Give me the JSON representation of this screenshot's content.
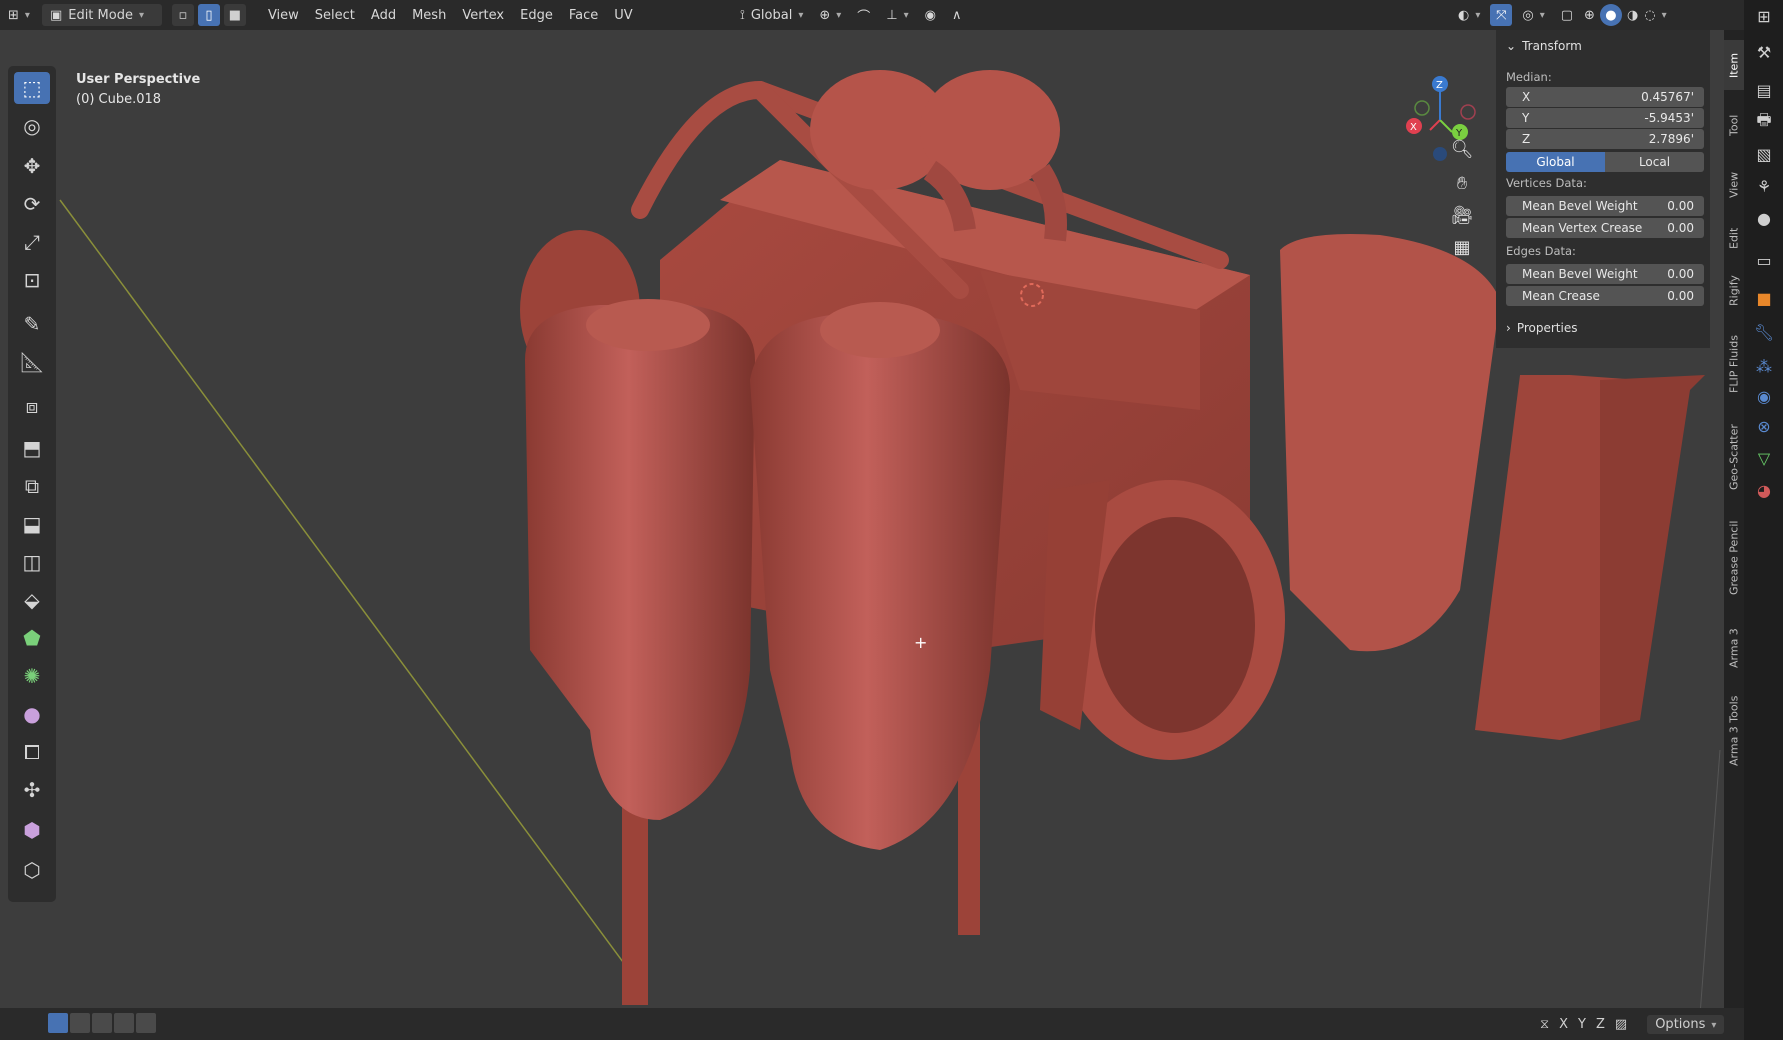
{
  "header": {
    "mode_label": "Edit Mode",
    "menu": [
      "View",
      "Select",
      "Add",
      "Mesh",
      "Vertex",
      "Edge",
      "Face",
      "UV"
    ],
    "transform_orientation": "Global"
  },
  "viewport": {
    "perspective_label": "User Perspective",
    "object_label": "(0) Cube.018"
  },
  "npanel": {
    "transform_title": "Transform",
    "median_label": "Median:",
    "x_label": "X",
    "x_value": "0.45767'",
    "y_label": "Y",
    "y_value": "-5.9453'",
    "z_label": "Z",
    "z_value": "2.7896'",
    "global_label": "Global",
    "local_label": "Local",
    "vertices_data_label": "Vertices Data:",
    "mean_bevel_weight_label": "Mean Bevel Weight",
    "mean_bevel_weight_value": "0.00",
    "mean_vertex_crease_label": "Mean Vertex Crease",
    "mean_vertex_crease_value": "0.00",
    "edges_data_label": "Edges Data:",
    "edge_mean_bevel_weight_label": "Mean Bevel Weight",
    "edge_mean_bevel_weight_value": "0.00",
    "mean_crease_label": "Mean Crease",
    "mean_crease_value": "0.00",
    "properties_label": "Properties"
  },
  "side_tabs": [
    "Item",
    "Tool",
    "View",
    "Edit",
    "Rigify",
    "FLIP Fluids",
    "Geo-Scatter",
    "Grease Pencil",
    "Arma 3",
    "Arma 3 Tools"
  ],
  "gizmo": {
    "x": "X",
    "y": "Y",
    "z": "Z"
  },
  "footer": {
    "axis_x": "X",
    "axis_y": "Y",
    "axis_z": "Z",
    "options_label": "Options"
  },
  "colors": {
    "accent": "#4772b3",
    "model": "#b5544a",
    "background": "#3d3d3d"
  }
}
